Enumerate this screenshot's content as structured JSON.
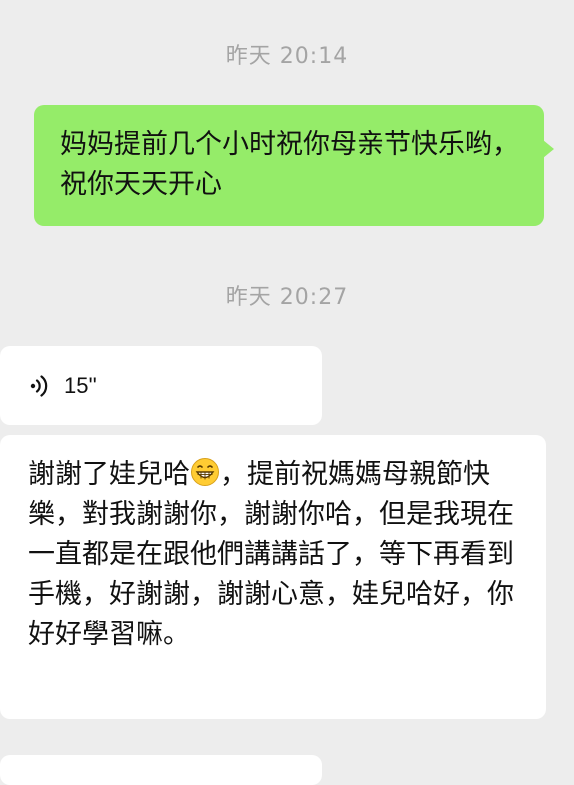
{
  "chat": {
    "timestamp_1": "昨天 20:14",
    "timestamp_2": "昨天 20:27",
    "sent_message": "妈妈提前几个小时祝你母亲节快乐哟，祝你天天开心",
    "voice_message": {
      "duration": "15''",
      "icon": "voice-wave-icon"
    },
    "received_message": {
      "before_emoji": "謝謝了娃兒哈",
      "emoji": "grinning-face-emoji",
      "after_emoji": "，提前祝媽媽母親節快樂，對我謝謝你，謝謝你哈，但是我現在一直都是在跟他們講講話了，等下再看到手機，好謝謝，謝謝心意，娃兒哈好，你好好學習嘛。"
    }
  },
  "colors": {
    "background": "#ededed",
    "sent_bubble": "#95ec69",
    "received_bubble": "#ffffff",
    "timestamp_text": "#a4a4a4"
  }
}
